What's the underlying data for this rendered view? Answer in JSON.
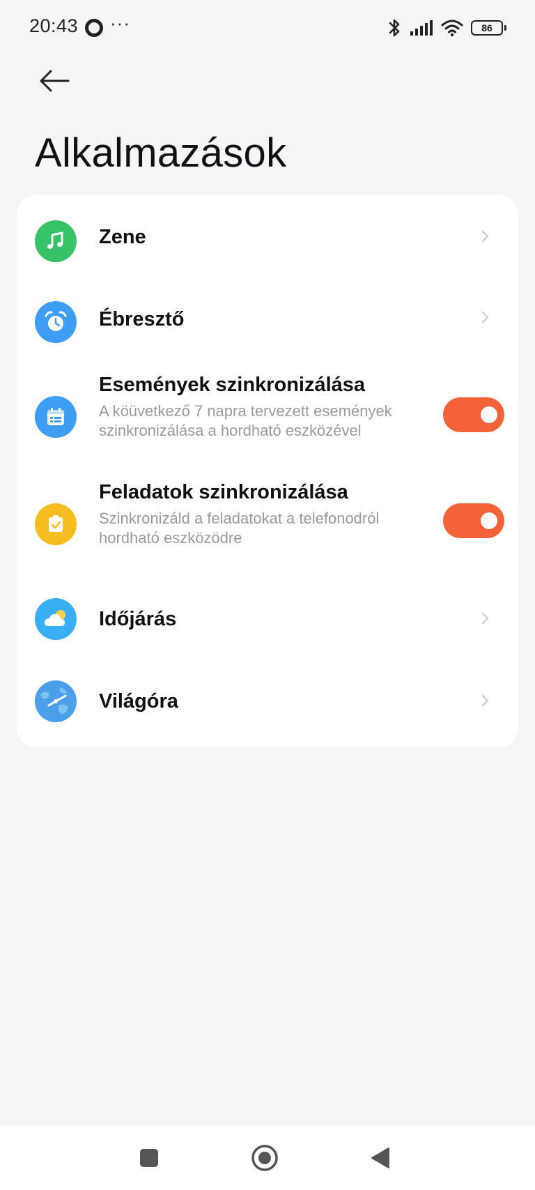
{
  "status_bar": {
    "time": "20:43",
    "dots": "···",
    "battery": "86"
  },
  "header": {
    "title": "Alkalmazások"
  },
  "apps": [
    {
      "id": "zene",
      "label": "Zene",
      "icon": "music-note-icon",
      "color": "#36c267"
    },
    {
      "id": "ebreszto",
      "label": "Ébresztő",
      "icon": "alarm-clock-icon",
      "color": "#3d9df2"
    },
    {
      "id": "esemenyek",
      "label": "Események szinkronizálása",
      "subtitle_line1": "A köüvetkező 7 napra tervezett események",
      "subtitle_line2": "szinkronizálása a hordható eszközével",
      "icon": "calendar-icon",
      "color": "#3d9df2",
      "toggle_on": true
    },
    {
      "id": "feladatok",
      "label": "Feladatok szinkronizálása",
      "subtitle_line1": "Szinkronizáld a feladatokat a telefonodról",
      "subtitle_line2": "hordható eszközödre",
      "icon": "task-check-icon",
      "color": "#f5bd1f",
      "toggle_on": true
    },
    {
      "id": "idojaras",
      "label": "Időjárás",
      "icon": "weather-cloud-icon",
      "color": "#3aaef3"
    },
    {
      "id": "vilagora",
      "label": "Világóra",
      "icon": "world-clock-icon",
      "color": "#4b9ee8"
    }
  ],
  "colors": {
    "toggle_on": "#f4623a",
    "background": "#f3f5f9",
    "card": "#ffffff",
    "subtitle": "#9a9a9a"
  }
}
